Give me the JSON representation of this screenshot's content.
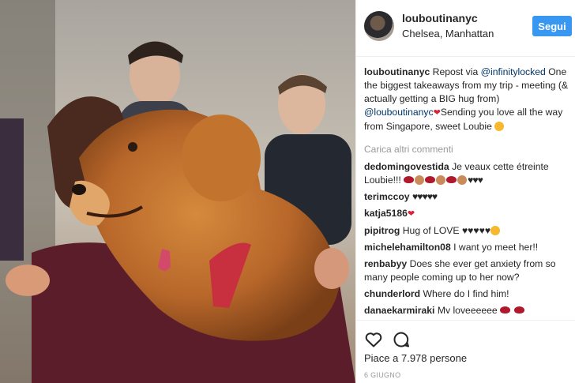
{
  "post": {
    "photo_alt_icon": "photo-of-woman-hugging-golden-retriever",
    "username": "louboutinanyc",
    "location": "Chelsea, Manhattan",
    "follow_label": "Segui"
  },
  "caption": {
    "user": "louboutinanyc",
    "part1": "Repost via ",
    "mention1": "@infinitylocked",
    "part2": "One the biggest takeaways from my trip - meeting (& actually getting a BIG hug from) ",
    "mention2": "@louboutinanyc",
    "part3": "Sending you love all the way from Singapore, sweet Loubie"
  },
  "load_more": "Carica altri commenti",
  "comments": [
    {
      "user": "dedomingovestida",
      "text": "Je veaux cette étreinte Loubie!!!"
    },
    {
      "user": "terimccoy",
      "text": "♥♥♥♥♥"
    },
    {
      "user": "katja5186",
      "text": ""
    },
    {
      "user": "pipitrog",
      "text": "Hug of LOVE ♥♥♥♥♥"
    },
    {
      "user": "michelehamilton08",
      "text": "I want yo meet her!!"
    },
    {
      "user": "renbabyy",
      "text": "Does she ever get anxiety from so many people coming up to her now?"
    },
    {
      "user": "chunderlord",
      "text": "Where do I find him!"
    },
    {
      "user": "danaekarmiraki",
      "text": "My loveeeeee"
    }
  ],
  "likes": "Piace a 7.978 persone",
  "date": "6 GIUGNO",
  "colors": {
    "accent": "#3897f0",
    "mention": "#003569",
    "muted": "#999999"
  }
}
